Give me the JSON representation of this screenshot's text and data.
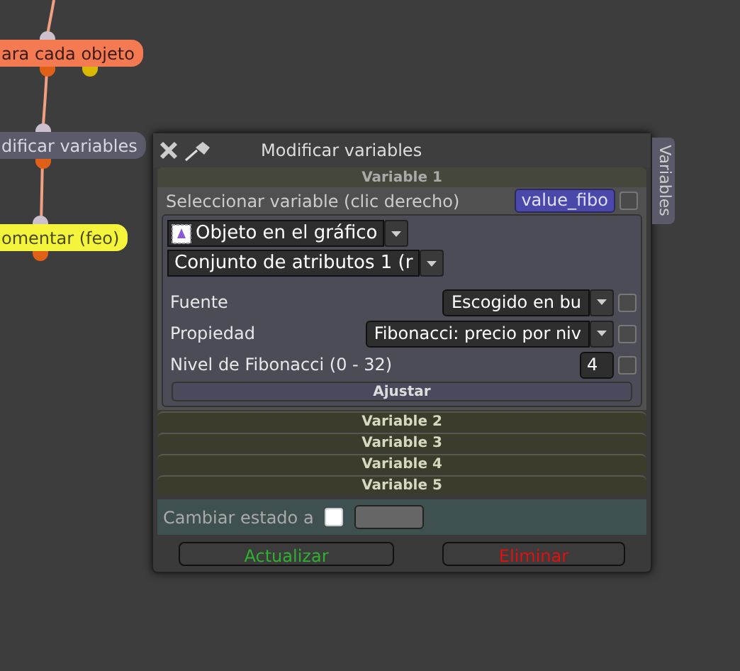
{
  "canvas": {
    "nodes": [
      {
        "label": "ara cada objeto",
        "color": "#f47a52"
      },
      {
        "label": "dificar variables",
        "color": "#5b5b6b"
      },
      {
        "label": "omentar (feo)",
        "color": "#f4f43c"
      }
    ]
  },
  "dialog": {
    "title": "Modificar variables",
    "side_tab": "Variables",
    "sections": [
      {
        "title": "Variable 1",
        "expanded": true,
        "select_label": "Seleccionar variable (clic derecho)",
        "variable_name": "value_fibo",
        "variable_checked": false,
        "object_dropdown": "Objeto en el gráfico",
        "attribute_dropdown": "Conjunto de atributos 1 (r",
        "rows": [
          {
            "kind": "dropdown",
            "label": "Fuente",
            "value": "Escogido en bu",
            "checked": false
          },
          {
            "kind": "dropdown",
            "label": "Propiedad",
            "value": "Fibonacci: precio por niv",
            "checked": false
          },
          {
            "kind": "number",
            "label": "Nivel de Fibonacci (0 - 32)",
            "value": "4",
            "checked": false
          }
        ],
        "button": "Ajustar"
      },
      {
        "title": "Variable 2",
        "expanded": false
      },
      {
        "title": "Variable 3",
        "expanded": false
      },
      {
        "title": "Variable 4",
        "expanded": false
      },
      {
        "title": "Variable 5",
        "expanded": false
      }
    ],
    "state_row": {
      "label": "Cambiar estado a",
      "checked": false
    },
    "buttons": [
      {
        "label": "Actualizar",
        "kind": "confirm"
      },
      {
        "label": "Eliminar",
        "kind": "danger"
      }
    ]
  }
}
